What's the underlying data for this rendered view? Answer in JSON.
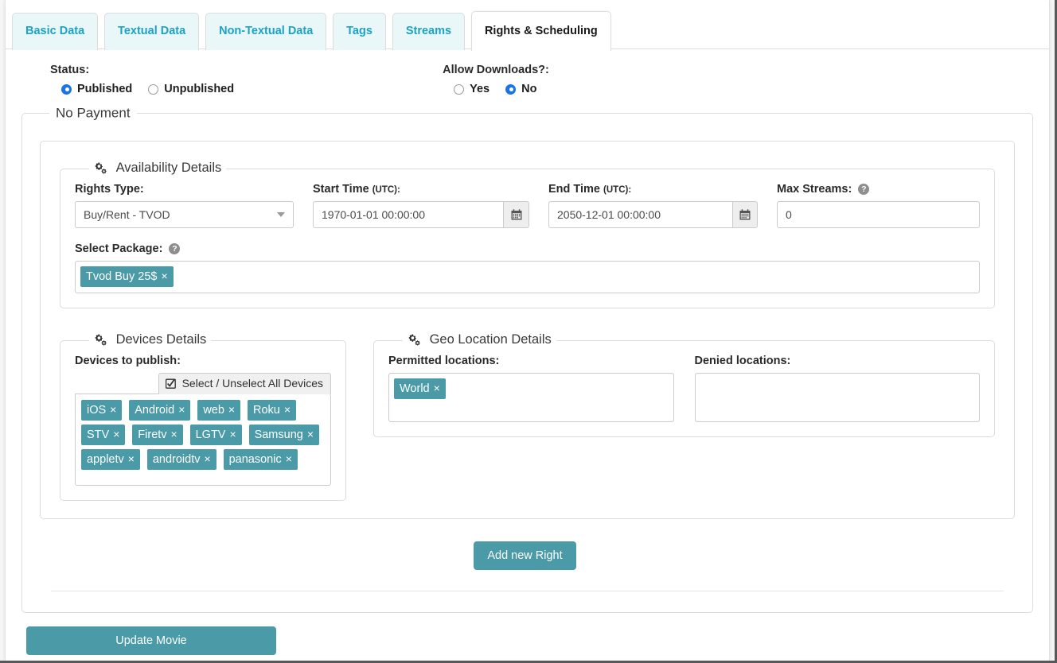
{
  "tabs": [
    {
      "label": "Basic Data",
      "active": false
    },
    {
      "label": "Textual Data",
      "active": false
    },
    {
      "label": "Non-Textual Data",
      "active": false
    },
    {
      "label": "Tags",
      "active": false
    },
    {
      "label": "Streams",
      "active": false
    },
    {
      "label": "Rights & Scheduling",
      "active": true
    }
  ],
  "status": {
    "label": "Status:",
    "options": [
      {
        "label": "Published",
        "selected": true
      },
      {
        "label": "Unpublished",
        "selected": false
      }
    ]
  },
  "allow_downloads": {
    "label": "Allow Downloads?:",
    "options": [
      {
        "label": "Yes",
        "selected": false
      },
      {
        "label": "No",
        "selected": true
      }
    ]
  },
  "payment_fieldset": {
    "legend": "No Payment"
  },
  "availability": {
    "legend": "Availability Details",
    "legend_icon": "cogs-icon",
    "rights_type": {
      "label": "Rights Type:",
      "value": "Buy/Rent - TVOD",
      "caret_icon": "chevron-down-icon"
    },
    "start_time": {
      "label": "Start Time",
      "label_sub": "(UTC):",
      "value": "1970-01-01 00:00:00",
      "button_icon": "calendar-icon"
    },
    "end_time": {
      "label": "End Time",
      "label_sub": "(UTC):",
      "value": "2050-12-01 00:00:00",
      "button_icon": "calendar-icon"
    },
    "max_streams": {
      "label": "Max Streams:",
      "help_icon": "question-circle-icon",
      "help_glyph": "?",
      "value": "0"
    },
    "select_package": {
      "label": "Select Package:",
      "help_icon": "question-circle-icon",
      "help_glyph": "?",
      "tokens": [
        "Tvod Buy 25$"
      ]
    }
  },
  "devices": {
    "legend": "Devices Details",
    "legend_icon": "cogs-icon",
    "label": "Devices to publish:",
    "select_all_label": "Select / Unselect All Devices",
    "select_all_icon": "checkbox-checked-icon",
    "tokens": [
      [
        "iOS",
        "Android",
        "web",
        "Roku"
      ],
      [
        "STV",
        "Firetv",
        "LGTV",
        "Samsung"
      ],
      [
        "appletv",
        "androidtv",
        "panasonic"
      ]
    ]
  },
  "geo": {
    "legend": "Geo Location Details",
    "legend_icon": "cogs-icon",
    "permitted": {
      "label": "Permitted locations:",
      "tokens": [
        "World"
      ]
    },
    "denied": {
      "label": "Denied locations:",
      "tokens": []
    }
  },
  "actions": {
    "add_right": "Add new Right",
    "update_movie": "Update Movie"
  },
  "token_remove_glyph": "×",
  "colors": {
    "teal": "#4a9aa7",
    "tab_link": "#1aa3c4",
    "tab_bg": "#e9f7f8",
    "radio_blue": "#1a73e8"
  }
}
